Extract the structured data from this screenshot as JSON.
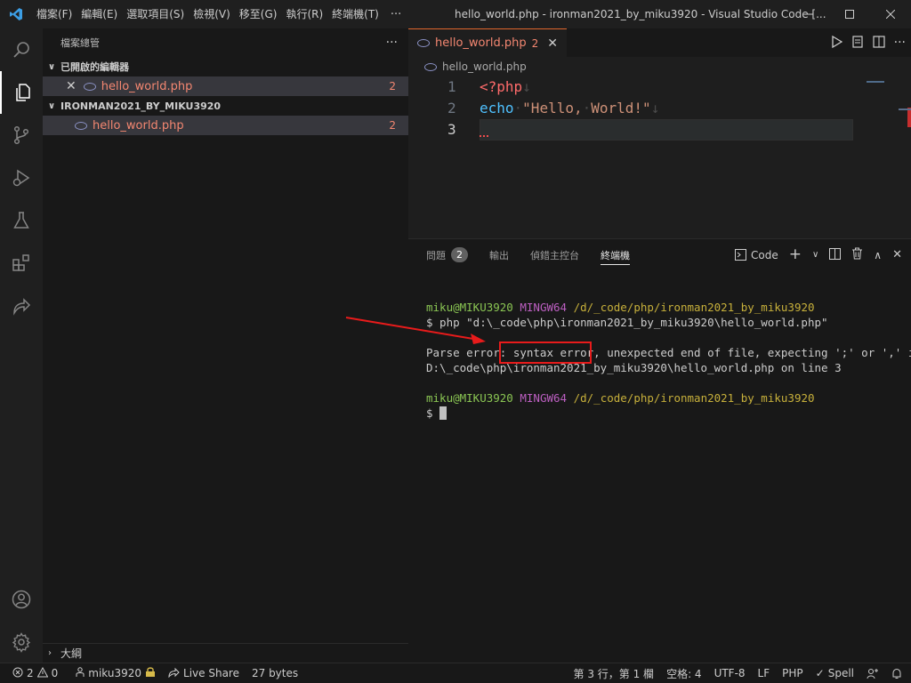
{
  "titlebar": {
    "menu": [
      "檔案(F)",
      "編輯(E)",
      "選取項目(S)",
      "檢視(V)",
      "移至(G)",
      "執行(R)",
      "終端機(T)"
    ],
    "more": "···",
    "window_title": "hello_world.php - ironman2021_by_miku3920 - Visual Studio Code [..."
  },
  "activity_bar": {
    "icons": [
      "search-icon",
      "explorer-icon",
      "source-control-icon",
      "run-debug-icon",
      "testing-icon",
      "extensions-icon",
      "live-share-icon",
      "account-icon",
      "settings-gear-icon"
    ]
  },
  "sidebar": {
    "title": "檔案總管",
    "more": "···",
    "open_editors_label": "已開啟的編輯器",
    "open_editors": [
      {
        "name": "hello_world.php",
        "count": "2"
      }
    ],
    "folder_label": "IRONMAN2021_BY_MIKU3920",
    "files": [
      {
        "name": "hello_world.php",
        "count": "2"
      }
    ],
    "outline_label": "大綱"
  },
  "editor": {
    "tab": {
      "name": "hello_world.php",
      "badge": "2"
    },
    "breadcrumb": "hello_world.php",
    "lines": [
      {
        "num": "1",
        "parts": [
          {
            "t": "<?php",
            "c": "#ff6b6b"
          },
          {
            "t": "↓",
            "c": "#4a4a4a"
          }
        ]
      },
      {
        "num": "2",
        "parts": [
          {
            "t": "echo",
            "c": "#4fc1ff"
          },
          {
            "t": "·",
            "c": "#4a4a4a"
          },
          {
            "t": "\"Hello,",
            "c": "#ce9178"
          },
          {
            "t": "·",
            "c": "#4a4a4a"
          },
          {
            "t": "World!\"",
            "c": "#ce9178"
          },
          {
            "t": "↓",
            "c": "#4a4a4a"
          }
        ]
      },
      {
        "num": "3",
        "parts": []
      }
    ]
  },
  "panel": {
    "tabs": [
      {
        "label": "問題",
        "badge": "2"
      },
      {
        "label": "輸出",
        "badge": ""
      },
      {
        "label": "偵錯主控台",
        "badge": ""
      },
      {
        "label": "終端機",
        "badge": ""
      }
    ],
    "terminal_name": "Code",
    "terminal": {
      "prompt1_user": "miku@MIKU3920",
      "prompt1_sys": "MINGW64",
      "prompt1_path": "/d/_code/php/ironman2021_by_miku3920",
      "command": "$ php \"d:\\_code\\php\\ironman2021_by_miku3920\\hello_world.php\"",
      "error_line1": "Parse error: syntax error, unexpected end of file, expecting ';' or ',' in",
      "error_line2": "D:\\_code\\php\\ironman2021_by_miku3920\\hello_world.php on line 3",
      "prompt2_user": "miku@MIKU3920",
      "prompt2_sys": "MINGW64",
      "prompt2_path": "/d/_code/php/ironman2021_by_miku3920",
      "prompt_symbol": "$ "
    }
  },
  "statusbar": {
    "errors": "2",
    "warnings": "0",
    "user": "miku3920",
    "live_share": "Live Share",
    "size": "27 bytes",
    "position": "第 3 行，第 1 欄",
    "spaces": "空格: 4",
    "encoding": "UTF-8",
    "eol": "LF",
    "language": "PHP",
    "spell": "Spell"
  },
  "colors": {
    "error": "#f48771",
    "annotation_red": "#e81b1b",
    "tab_accent": "#e0662c"
  }
}
